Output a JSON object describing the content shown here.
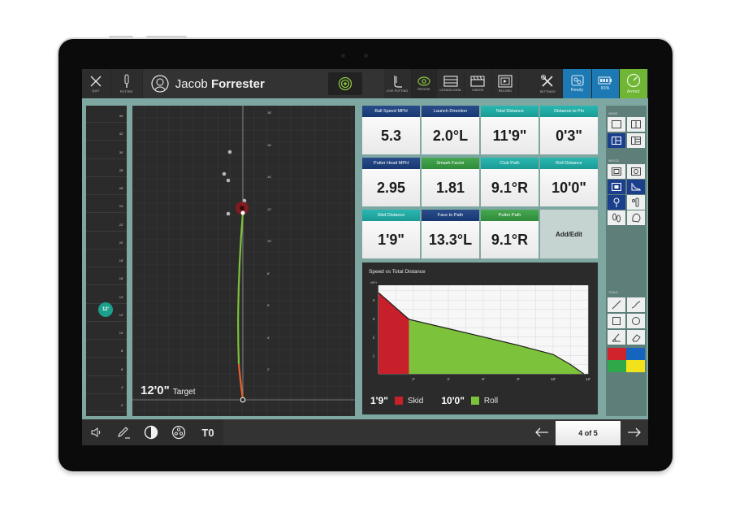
{
  "topbar": {
    "quit_label": "QUIT",
    "putter_label": "PUTTER",
    "user_first": "Jacob",
    "user_last": "Forrester",
    "nav": [
      {
        "label": "LIVE PUTTING",
        "icon": "putter-stance-icon"
      },
      {
        "label": "REVIEW",
        "icon": "eye-icon"
      },
      {
        "label": "LESSON DATA",
        "icon": "table-icon"
      },
      {
        "label": "VIDEOS",
        "icon": "clapperboard-icon"
      },
      {
        "label": "RECORD",
        "icon": "record-icon"
      },
      {
        "label": "SETTINGS",
        "icon": "wrench-screwdriver-icon"
      }
    ],
    "status": [
      {
        "label": "Ready",
        "icon": "camera-status-icon",
        "color": "#1d79b4"
      },
      {
        "label": "83%",
        "icon": "battery-icon",
        "color": "#1d79b4"
      },
      {
        "label": "Armed",
        "icon": "gauge-icon",
        "color": "#6fb634"
      }
    ]
  },
  "strip": {
    "ticks": [
      "34'",
      "32'",
      "30'",
      "28'",
      "26'",
      "24'",
      "22'",
      "20'",
      "18'",
      "16'",
      "14'",
      "12'",
      "10'",
      "8'",
      "6'",
      "4'",
      "2'"
    ],
    "current_badge": "12'"
  },
  "putt_view": {
    "ticks": [
      "18'",
      "16'",
      "14'",
      "12'",
      "10'",
      "8'",
      "6'",
      "4'",
      "2'"
    ],
    "target_value": "12'0\"",
    "target_label": "Target"
  },
  "metrics": [
    {
      "label": "Ball Speed MPH",
      "value": "5.3",
      "color": "navy"
    },
    {
      "label": "Launch Direction",
      "value": "2.0°L",
      "color": "navy"
    },
    {
      "label": "Total Distance",
      "value": "11'9\"",
      "color": "teal"
    },
    {
      "label": "Distance to Pin",
      "value": "0'3\"",
      "color": "teal"
    },
    {
      "label": "Putter Head MPH",
      "value": "2.95",
      "color": "navy"
    },
    {
      "label": "Smash Factor",
      "value": "1.81",
      "color": "green"
    },
    {
      "label": "Club Path",
      "value": "9.1°R",
      "color": "teal"
    },
    {
      "label": "Roll Distance",
      "value": "10'0\"",
      "color": "teal"
    },
    {
      "label": "Skid Distance",
      "value": "1'9\"",
      "color": "teal"
    },
    {
      "label": "Face to Path",
      "value": "13.3°L",
      "color": "navy"
    },
    {
      "label": "Putter Path",
      "value": "9.1°R",
      "color": "green"
    }
  ],
  "add_edit_label": "Add/Edit",
  "chart_data": {
    "type": "area",
    "title": "Speed vs Total Distance",
    "xlabel": "",
    "ylabel": "MPH",
    "xlim": [
      0,
      12
    ],
    "ylim": [
      0,
      4.8
    ],
    "x_ticks": [
      "2'",
      "4'",
      "6'",
      "8'",
      "10'",
      "12'"
    ],
    "x_tick_values": [
      2,
      4,
      6,
      8,
      10,
      12
    ],
    "y_ticks": [
      "1",
      "2",
      "3",
      "4"
    ],
    "y_tick_values": [
      1,
      2,
      3,
      4
    ],
    "grid": true,
    "series": [
      {
        "name": "Skid",
        "color": "#c8202a",
        "points": [
          [
            0,
            4.4
          ],
          [
            1.75,
            2.95
          ]
        ]
      },
      {
        "name": "Roll",
        "color": "#7cc23a",
        "points": [
          [
            1.75,
            2.95
          ],
          [
            4,
            2.45
          ],
          [
            6,
            2.0
          ],
          [
            8,
            1.55
          ],
          [
            10,
            1.05
          ],
          [
            11,
            0.5
          ],
          [
            11.75,
            0
          ]
        ]
      }
    ]
  },
  "legend": {
    "skid_value": "1'9\"",
    "skid_label": "Skid",
    "roll_value": "10'0\"",
    "roll_label": "Roll"
  },
  "tools": {
    "views_label": "VIEWS",
    "inputs_label": "INPUTS",
    "tools_label": "TOOLS",
    "colors": [
      "#d0232b",
      "#1565c0",
      "#2fa84a",
      "#f2e21b"
    ]
  },
  "bottombar": {
    "page_indicator": "4 of 5",
    "text_tool_label": "T0"
  }
}
